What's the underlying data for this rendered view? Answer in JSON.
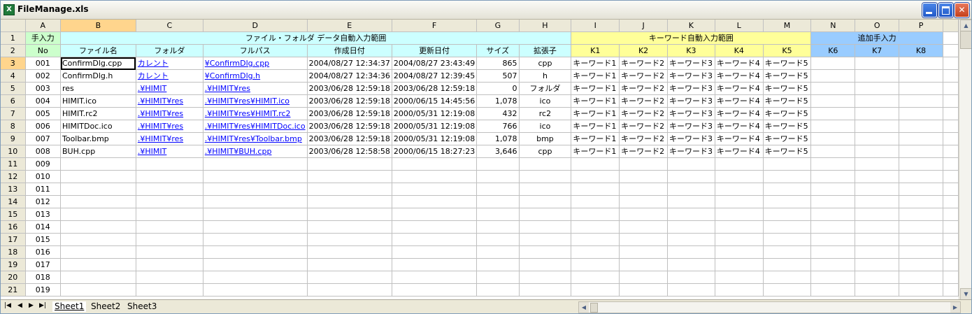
{
  "window": {
    "title": "FileManage.xls"
  },
  "columns": [
    "A",
    "B",
    "C",
    "D",
    "E",
    "F",
    "G",
    "H",
    "I",
    "J",
    "K",
    "L",
    "M",
    "N",
    "O",
    "P"
  ],
  "header1": {
    "manual_input": "手入力",
    "auto_range": "ファイル・フォルダ データ自動入力範囲",
    "keyword_range": "キーワード自動入力範囲",
    "extra_input": "追加手入力"
  },
  "header2": [
    "No",
    "ファイル名",
    "フォルダ",
    "フルパス",
    "作成日付",
    "更新日付",
    "サイズ",
    "拡張子",
    "K1",
    "K2",
    "K3",
    "K4",
    "K5",
    "K6",
    "K7",
    "K8"
  ],
  "rows": [
    {
      "rownum": "3",
      "no": "001",
      "name": "ConfirmDlg.cpp",
      "folder": "カレント",
      "path": "¥ConfirmDlg.cpp",
      "created": "2004/08/27 12:34:37",
      "updated": "2004/08/27 23:43:49",
      "size": "865",
      "ext": "cpp",
      "k1": "キーワード1",
      "k2": "キーワード2",
      "k3": "キーワード3",
      "k4": "キーワード4",
      "k5": "キーワード5"
    },
    {
      "rownum": "4",
      "no": "002",
      "name": "ConfirmDlg.h",
      "folder": "カレント",
      "path": "¥ConfirmDlg.h",
      "created": "2004/08/27 12:34:36",
      "updated": "2004/08/27 12:39:45",
      "size": "507",
      "ext": "h",
      "k1": "キーワード1",
      "k2": "キーワード2",
      "k3": "キーワード3",
      "k4": "キーワード4",
      "k5": "キーワード5"
    },
    {
      "rownum": "5",
      "no": "003",
      "name": "res",
      "folder": ".¥HIMIT",
      "path": ".¥HIMIT¥res",
      "created": "2003/06/28 12:59:18",
      "updated": "2003/06/28 12:59:18",
      "size": "0",
      "ext": "フォルダ",
      "k1": "キーワード1",
      "k2": "キーワード2",
      "k3": "キーワード3",
      "k4": "キーワード4",
      "k5": "キーワード5"
    },
    {
      "rownum": "6",
      "no": "004",
      "name": "HIMIT.ico",
      "folder": ".¥HIMIT¥res",
      "path": ".¥HIMIT¥res¥HIMIT.ico",
      "created": "2003/06/28 12:59:18",
      "updated": "2000/06/15 14:45:56",
      "size": "1,078",
      "ext": "ico",
      "k1": "キーワード1",
      "k2": "キーワード2",
      "k3": "キーワード3",
      "k4": "キーワード4",
      "k5": "キーワード5"
    },
    {
      "rownum": "7",
      "no": "005",
      "name": "HIMIT.rc2",
      "folder": ".¥HIMIT¥res",
      "path": ".¥HIMIT¥res¥HIMIT.rc2",
      "created": "2003/06/28 12:59:18",
      "updated": "2000/05/31 12:19:08",
      "size": "432",
      "ext": "rc2",
      "k1": "キーワード1",
      "k2": "キーワード2",
      "k3": "キーワード3",
      "k4": "キーワード4",
      "k5": "キーワード5"
    },
    {
      "rownum": "8",
      "no": "006",
      "name": "HIMITDoc.ico",
      "folder": ".¥HIMIT¥res",
      "path": ".¥HIMIT¥res¥HIMITDoc.ico",
      "created": "2003/06/28 12:59:18",
      "updated": "2000/05/31 12:19:08",
      "size": "766",
      "ext": "ico",
      "k1": "キーワード1",
      "k2": "キーワード2",
      "k3": "キーワード3",
      "k4": "キーワード4",
      "k5": "キーワード5"
    },
    {
      "rownum": "9",
      "no": "007",
      "name": "Toolbar.bmp",
      "folder": ".¥HIMIT¥res",
      "path": ".¥HIMIT¥res¥Toolbar.bmp",
      "created": "2003/06/28 12:59:18",
      "updated": "2000/05/31 12:19:08",
      "size": "1,078",
      "ext": "bmp",
      "k1": "キーワード1",
      "k2": "キーワード2",
      "k3": "キーワード3",
      "k4": "キーワード4",
      "k5": "キーワード5"
    },
    {
      "rownum": "10",
      "no": "008",
      "name": "BUH.cpp",
      "folder": ".¥HIMIT",
      "path": ".¥HIMIT¥BUH.cpp",
      "created": "2003/06/28 12:58:58",
      "updated": "2000/06/15 18:27:23",
      "size": "3,646",
      "ext": "cpp",
      "k1": "キーワード1",
      "k2": "キーワード2",
      "k3": "キーワード3",
      "k4": "キーワード4",
      "k5": "キーワード5"
    }
  ],
  "empty_rows": [
    {
      "rownum": "11",
      "no": "009"
    },
    {
      "rownum": "12",
      "no": "010"
    },
    {
      "rownum": "13",
      "no": "011"
    },
    {
      "rownum": "14",
      "no": "012"
    },
    {
      "rownum": "15",
      "no": "013"
    },
    {
      "rownum": "16",
      "no": "014"
    },
    {
      "rownum": "17",
      "no": "015"
    },
    {
      "rownum": "18",
      "no": "016"
    },
    {
      "rownum": "19",
      "no": "017"
    },
    {
      "rownum": "20",
      "no": "018"
    },
    {
      "rownum": "21",
      "no": "019"
    }
  ],
  "sheets": [
    "Sheet1",
    "Sheet2",
    "Sheet3"
  ],
  "colors": {
    "manual": "#ccffcc",
    "auto": "#ccffff",
    "keyword": "#ffff99",
    "extra": "#99ccff",
    "link": "#0000ff"
  }
}
